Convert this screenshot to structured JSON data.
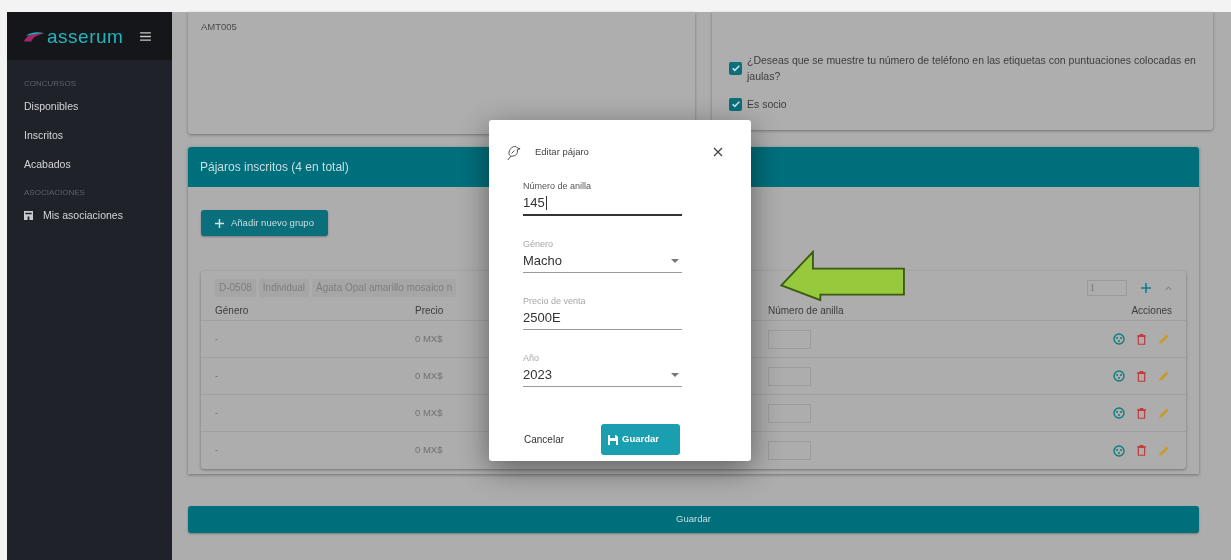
{
  "sidebar": {
    "logo_text": "asserum",
    "sections": [
      {
        "title": "CONCURSOS",
        "items": [
          {
            "label": "Disponibles",
            "kind": "plain"
          },
          {
            "label": "Inscritos",
            "kind": "plain"
          },
          {
            "label": "Acabados",
            "kind": "plain"
          }
        ]
      },
      {
        "title": "ASOCIACIONES",
        "items": [
          {
            "label": "Mis asociaciones",
            "kind": "icon"
          }
        ]
      }
    ]
  },
  "profile_card": {
    "code": "AMT005"
  },
  "options": [
    {
      "label": "¿Deseas que se muestre tu número de teléfono en las etiquetas con puntuaciones colocadas en jaulas?",
      "checked": true
    },
    {
      "label": "Es socio",
      "checked": true
    }
  ],
  "birds_panel": {
    "title": "Pájaros inscritos (4 en total)",
    "add_button": "Añadir nuevo grupo",
    "group": {
      "tags": [
        "D-0508",
        "Individual",
        "Ágata Opal amarillo mosaico n"
      ],
      "quantity": "1",
      "expanded": true,
      "columns": [
        "Género",
        "Precio",
        "Número de anilla",
        "Acciones"
      ],
      "rows": [
        {
          "genero": "-",
          "precio": "0 MX$"
        },
        {
          "genero": "-",
          "precio": "0 MX$"
        },
        {
          "genero": "-",
          "precio": "0 MX$"
        },
        {
          "genero": "-",
          "precio": "0 MX$"
        }
      ]
    }
  },
  "save_button": "Guardar",
  "dialog": {
    "title": "Editar pájaro",
    "fields": [
      {
        "label": "Número de anilla",
        "value": "145",
        "kind": "text",
        "focused": true
      },
      {
        "label": "Género",
        "value": "Macho",
        "kind": "select",
        "focused": false
      },
      {
        "label": "Precio de venta",
        "value": "2500E",
        "kind": "text",
        "focused": false
      },
      {
        "label": "Año",
        "value": "2023",
        "kind": "select",
        "focused": false
      }
    ],
    "cancel": "Cancelar",
    "confirm": "Guardar"
  }
}
